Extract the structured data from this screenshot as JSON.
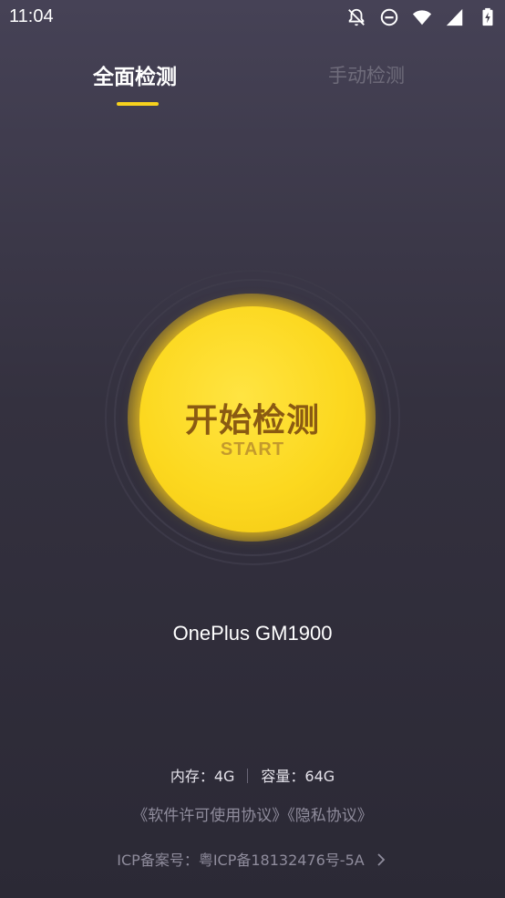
{
  "statusbar": {
    "time": "11:04",
    "icons": [
      "notifications-off-icon",
      "do-not-disturb-icon",
      "wifi-icon",
      "signal-icon",
      "battery-charging-icon"
    ]
  },
  "tabs": [
    {
      "label": "全面检测",
      "active": true
    },
    {
      "label": "手动检测",
      "active": false
    }
  ],
  "start_button": {
    "label": "开始检测",
    "sub_label": "START",
    "color": "#fcd81f"
  },
  "device": {
    "model": "OnePlus GM1900"
  },
  "specs": {
    "memory": "内存：4G",
    "storage": "容量：64G"
  },
  "links": {
    "license": "《软件许可使用协议》",
    "privacy": "《隐私协议》"
  },
  "icp": {
    "text": "ICP备案号：粤ICP备18132476号-5A"
  },
  "colors": {
    "accent": "#f7d21d",
    "inactive_tab": "#6f6c7b"
  }
}
